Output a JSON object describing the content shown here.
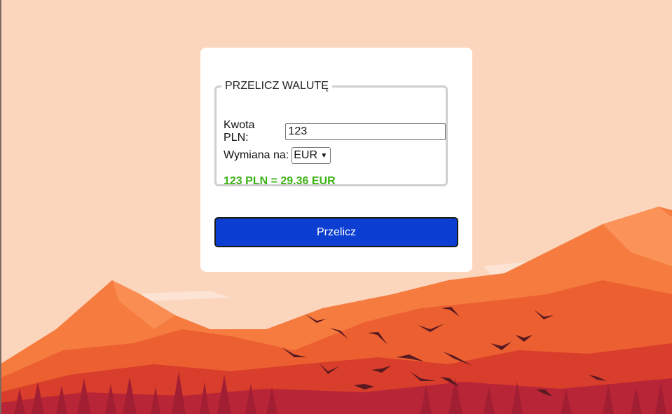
{
  "form": {
    "legend": "PRZELICZ WALUTĘ",
    "amount_label": "Kwota PLN:",
    "amount_value": "123",
    "exchange_label": "Wymiana na:",
    "currency_selected": "EUR",
    "result_text": "123 PLN = 29.36 EUR",
    "submit_label": "Przelicz"
  },
  "colors": {
    "sky": "#fcd5bd",
    "result": "#3bb214",
    "button": "#0b3ed1"
  }
}
